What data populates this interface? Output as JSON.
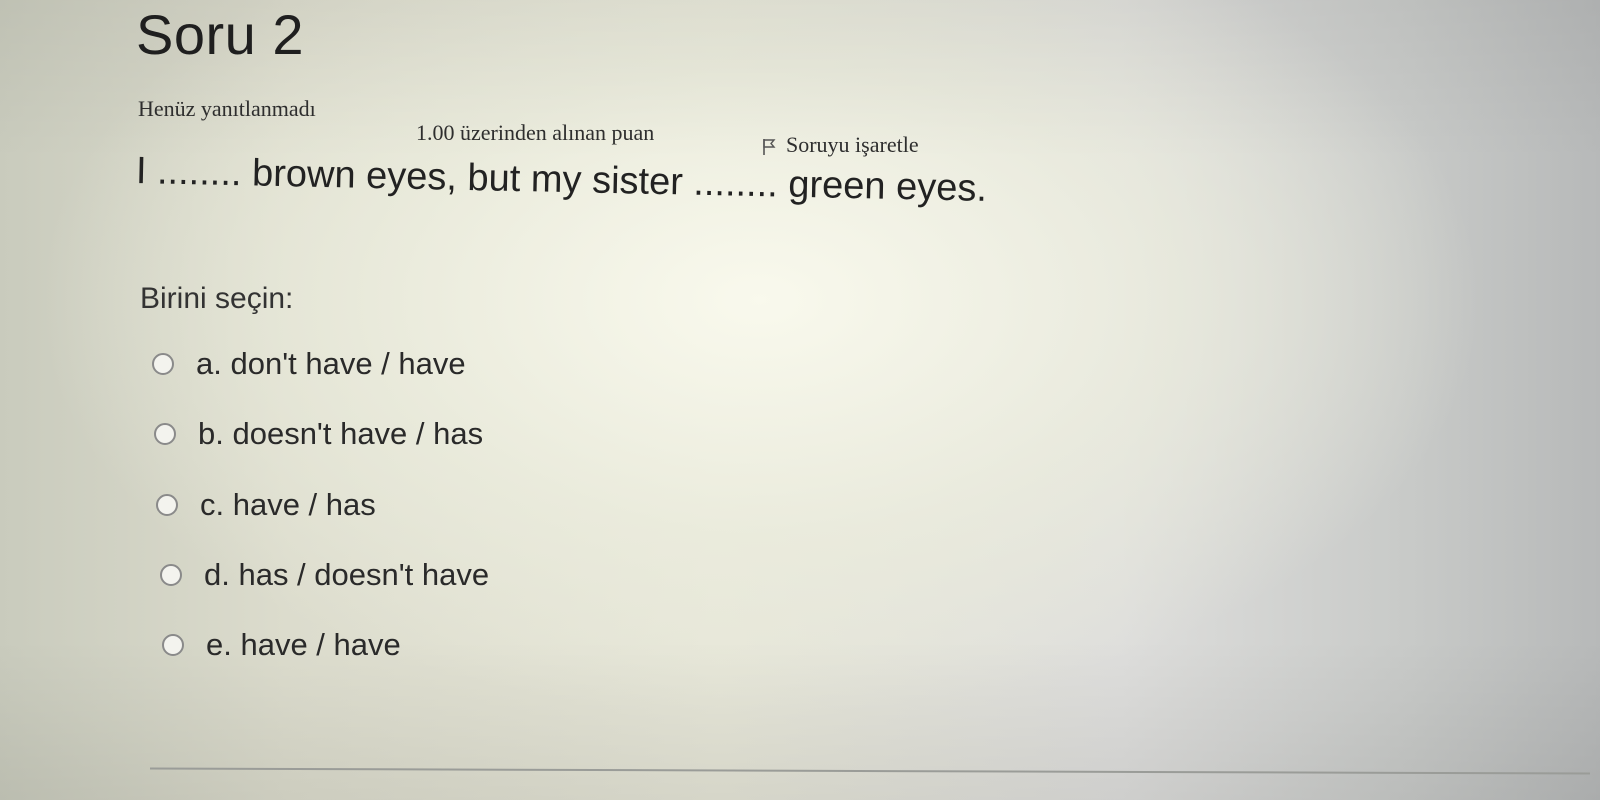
{
  "question": {
    "title": "Soru 2",
    "status": "Henüz yanıtlanmadı",
    "grade": "1.00 üzerinden alınan puan",
    "flag_label": "Soruyu işaretle",
    "flag_icon": "flag-icon",
    "text": "I ........ brown eyes, but my sister ........ green eyes.",
    "prompt": "Birini seçin:",
    "answers": [
      {
        "label": "a. don't have / have",
        "selected": false
      },
      {
        "label": "b. doesn't have / has",
        "selected": false
      },
      {
        "label": "c. have / has",
        "selected": false
      },
      {
        "label": "d. has / doesn't have",
        "selected": false
      },
      {
        "label": "e. have / have",
        "selected": false
      }
    ]
  }
}
